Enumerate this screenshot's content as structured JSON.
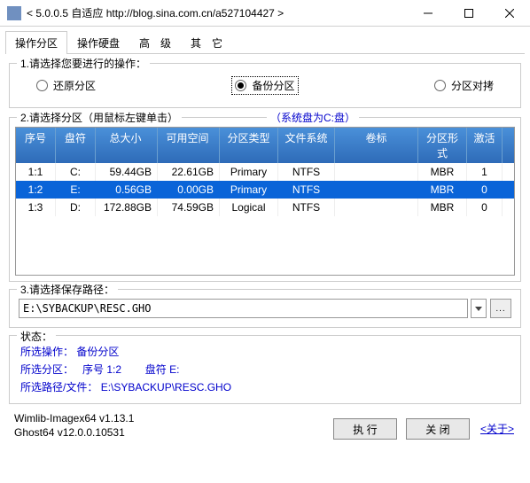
{
  "window": {
    "title": "< 5.0.0.5 自适应 http://blog.sina.com.cn/a527104427 >"
  },
  "tabs": {
    "items": [
      {
        "label": "操作分区",
        "active": true
      },
      {
        "label": "操作硬盘",
        "active": false
      },
      {
        "label": "高　级",
        "active": false
      },
      {
        "label": "其　它",
        "active": false
      }
    ]
  },
  "step1": {
    "label": "1.请选择您要进行的操作：",
    "options": [
      {
        "label": "还原分区",
        "checked": false,
        "boxed": false
      },
      {
        "label": "备份分区",
        "checked": true,
        "boxed": true
      },
      {
        "label": "分区对拷",
        "checked": false,
        "boxed": false
      }
    ]
  },
  "step2": {
    "label": "2.请选择分区（用鼠标左键单击）",
    "syshint": "（系统盘为C:盘）",
    "headers": [
      "序号",
      "盘符",
      "总大小",
      "可用空间",
      "分区类型",
      "文件系统",
      "卷标",
      "分区形式",
      "激活"
    ],
    "rows": [
      {
        "seq": "1:1",
        "drive": "C:",
        "size": "59.44GB",
        "free": "22.61GB",
        "ptype": "Primary",
        "fs": "NTFS",
        "label": "",
        "pform": "MBR",
        "active": "1",
        "selected": false
      },
      {
        "seq": "1:2",
        "drive": "E:",
        "size": "0.56GB",
        "free": "0.00GB",
        "ptype": "Primary",
        "fs": "NTFS",
        "label": "",
        "pform": "MBR",
        "active": "0",
        "selected": true
      },
      {
        "seq": "1:3",
        "drive": "D:",
        "size": "172.88GB",
        "free": "74.59GB",
        "ptype": "Logical",
        "fs": "NTFS",
        "label": "",
        "pform": "MBR",
        "active": "0",
        "selected": false
      }
    ]
  },
  "step3": {
    "label": "3.请选择保存路径：",
    "path": "E:\\SYBACKUP\\RESC.GHO",
    "browse": "..."
  },
  "status": {
    "label": "状态：",
    "op_lbl": "所选操作：",
    "op_val": "备份分区",
    "part_lbl": "所选分区：",
    "seq_lbl": "序号 1:2",
    "drive_lbl": "盘符 E:",
    "path_lbl": "所选路径/文件：",
    "path_val": "E:\\SYBACKUP\\RESC.GHO"
  },
  "footer": {
    "ver1": "Wimlib-Imagex64 v1.13.1",
    "ver2": "Ghost64 v12.0.0.10531",
    "execute": "执 行",
    "close": "关 闭",
    "about": "<关于>"
  }
}
